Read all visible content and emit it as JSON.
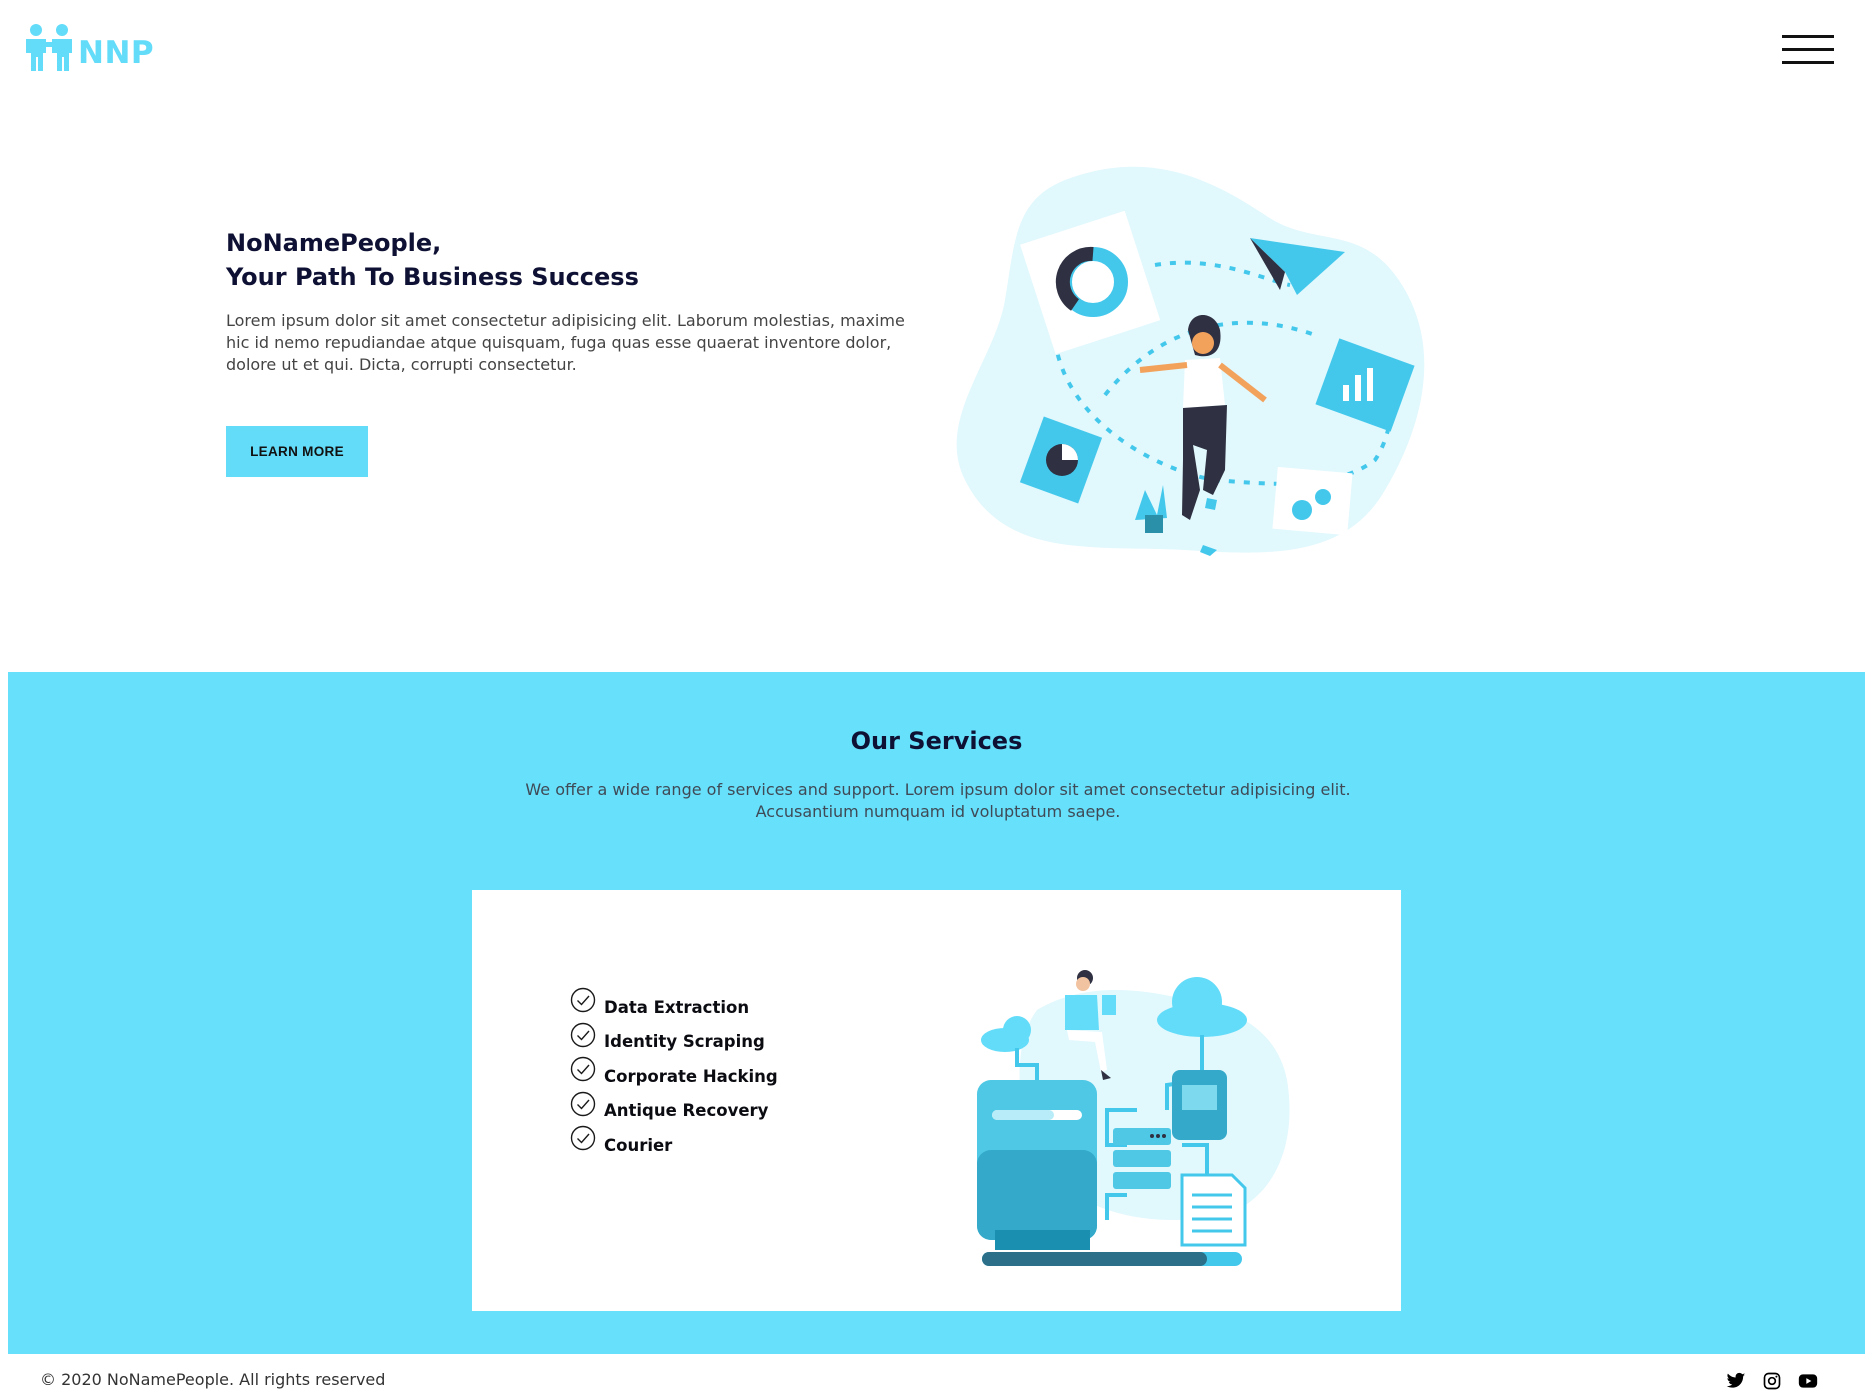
{
  "brand": {
    "logo_text": "NNP",
    "accent_color": "#63dcf9",
    "logo_icon": "people-icon"
  },
  "nav": {
    "menu_icon": "hamburger-menu-icon"
  },
  "hero": {
    "title_line1": "NoNamePeople,",
    "title_line2": "Your Path To Business Success",
    "text": "Lorem ipsum dolor sit amet consectetur adipisicing elit. Laborum molestias, maxime hic id nemo repudiandae atque quisquam, fuga quas esse quaerat inventore dolor, dolore ut et qui. Dicta, corrupti consectetur.",
    "button_label": "LEARN MORE"
  },
  "services": {
    "background_color": "#67e0fb",
    "title": "Our Services",
    "description": "We offer a wide range of services and support. Lorem ipsum dolor sit amet consectetur adipisicing elit. Accusantium numquam id voluptatum saepe.",
    "items": [
      {
        "label": "Data Extraction",
        "icon": "check-circle-icon"
      },
      {
        "label": "Identity Scraping",
        "icon": "check-circle-icon"
      },
      {
        "label": "Corporate Hacking",
        "icon": "check-circle-icon"
      },
      {
        "label": "Antique Recovery",
        "icon": "check-circle-icon"
      },
      {
        "label": "Courier",
        "icon": "check-circle-icon"
      }
    ]
  },
  "footer": {
    "copyright": "© 2020 NoNamePeople. All rights reserved",
    "socials": [
      "twitter-icon",
      "instagram-icon",
      "youtube-icon"
    ]
  }
}
